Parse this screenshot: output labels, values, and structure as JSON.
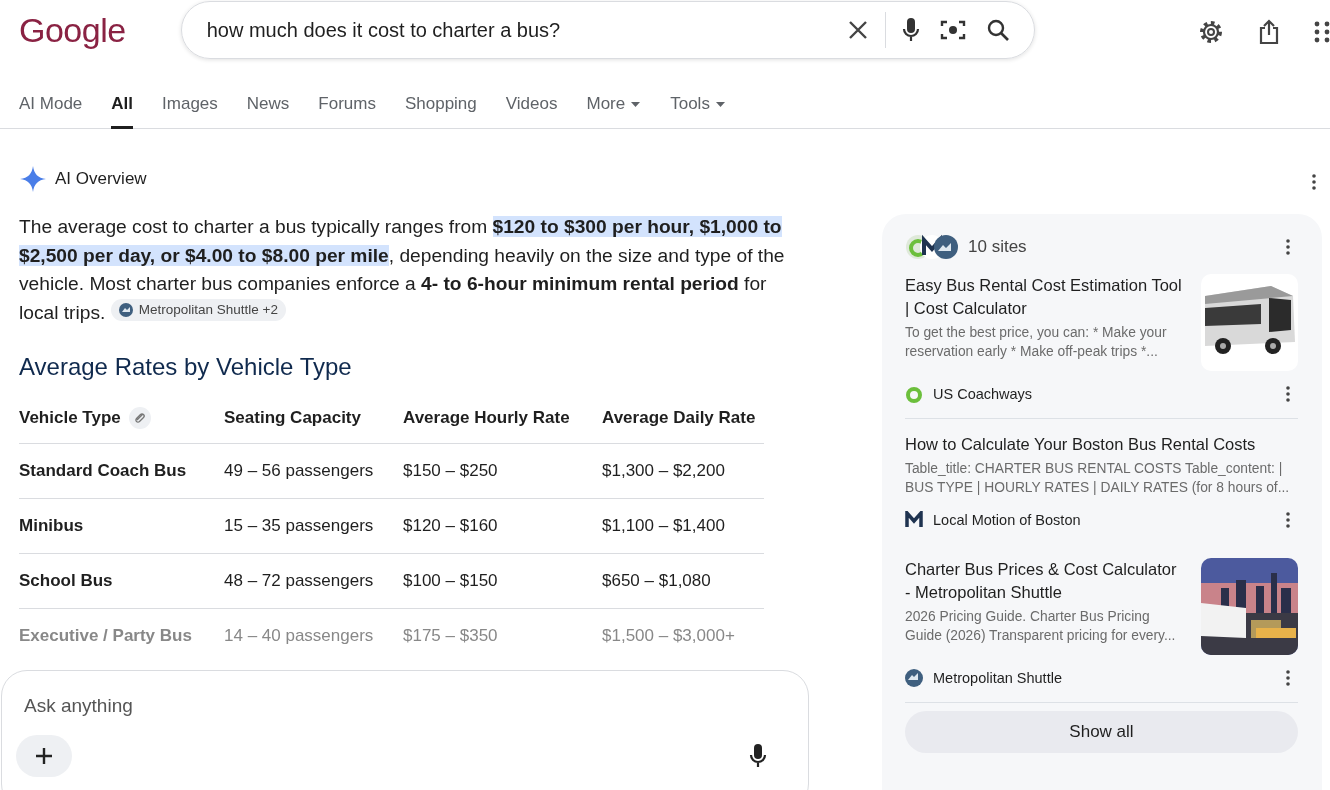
{
  "logo": "Google",
  "search": {
    "value": "how much does it cost to charter a bus?"
  },
  "tabs": [
    {
      "label": "AI Mode",
      "selected": false,
      "dropdown": false
    },
    {
      "label": "All",
      "selected": true,
      "dropdown": false
    },
    {
      "label": "Images",
      "selected": false,
      "dropdown": false
    },
    {
      "label": "News",
      "selected": false,
      "dropdown": false
    },
    {
      "label": "Forums",
      "selected": false,
      "dropdown": false
    },
    {
      "label": "Shopping",
      "selected": false,
      "dropdown": false
    },
    {
      "label": "Videos",
      "selected": false,
      "dropdown": false
    },
    {
      "label": "More",
      "selected": false,
      "dropdown": true
    },
    {
      "label": "Tools",
      "selected": false,
      "dropdown": true
    }
  ],
  "overview": {
    "title": "AI Overview",
    "paragraph": [
      {
        "text": "The average cost to charter a bus typically ranges from ",
        "highlighted": false
      },
      {
        "text": "**$120 to $300 per hour, $1,000 to $2,500 per day, or $4.00 to $8.00 per mile**",
        "highlighted": true
      },
      {
        "text": ", depending heavily on the size and type of the vehicle. Most charter bus companies enforce a **4- to 6-hour minimum rental period** for local trips. ",
        "highlighted": false
      }
    ],
    "citation": "Metropolitan Shuttle +2",
    "heading": "Average Rates by Vehicle Type",
    "table": {
      "columns": [
        "Vehicle Type",
        "Seating Capacity",
        "Average Hourly Rate",
        "Average Daily Rate"
      ],
      "rows": [
        {
          "cells": [
            "Standard Coach Bus",
            "49 – 56 passengers",
            "$150 – $250",
            "$1,300 – $2,200"
          ],
          "faded": false
        },
        {
          "cells": [
            "Minibus",
            "15 – 35 passengers",
            "$120 – $160",
            "$1,100 – $1,400"
          ],
          "faded": false
        },
        {
          "cells": [
            "School Bus",
            "48 – 72 passengers",
            "$100 – $150",
            "$650 – $1,080"
          ],
          "faded": false
        },
        {
          "cells": [
            "Executive / Party Bus",
            "14 – 40 passengers",
            "$175 – $350",
            "$1,500 – $3,000+"
          ],
          "faded": true
        }
      ]
    }
  },
  "sources": {
    "count": "10 sites",
    "items": [
      {
        "title": "Easy Bus Rental Cost Estimation Tool | Cost Calculator",
        "snippet": "To get the best price, you can: * Make your reservation early * Make off-peak trips *...",
        "site": "US Coachways"
      },
      {
        "title": "How to Calculate Your Boston Bus Rental Costs",
        "snippet": "Table_title: CHARTER BUS RENTAL COSTS Table_content: | BUS TYPE | HOURLY RATES | DAILY RATES (for 8 hours of...",
        "site": "Local Motion of Boston"
      },
      {
        "title": "Charter Bus Prices & Cost Calculator - Metropolitan Shuttle",
        "snippet": "2026 Pricing Guide. Charter Bus Pricing Guide (2026) Transparent pricing for every...",
        "site": "Metropolitan Shuttle"
      }
    ],
    "button": "Show all"
  },
  "ask": {
    "placeholder": "Ask anything"
  }
}
